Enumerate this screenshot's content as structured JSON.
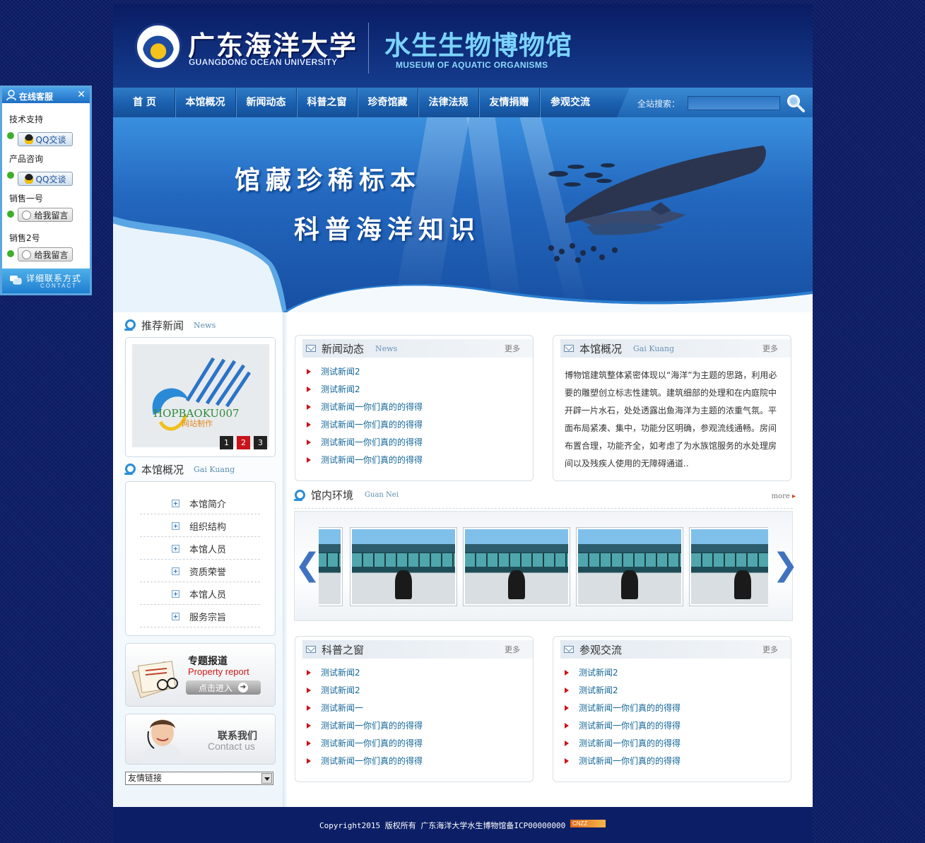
{
  "header": {
    "university_cn": "广东海洋大学",
    "university_en": "GUANGDONG OCEAN UNIVERSITY",
    "museum_cn": "水生生物博物馆",
    "museum_en": "MUSEUM OF AQUATIC ORGANISMS"
  },
  "nav": {
    "items": [
      "首 页",
      "本馆概况",
      "新闻动态",
      "科普之窗",
      "珍奇馆藏",
      "法律法规",
      "友情捐赠",
      "参观交流"
    ],
    "search_label": "全站搜索：",
    "search_value": ""
  },
  "banner": {
    "line1": "馆藏珍稀标本",
    "line2": "科普海洋知识"
  },
  "left": {
    "news_title": "推荐新闻",
    "news_en": "News",
    "news_img_text": "HOPBAOKU007",
    "news_img_sub": "网站制作",
    "slides": [
      "1",
      "2",
      "3"
    ],
    "about_title": "本馆概况",
    "about_en": "Gai Kuang",
    "menu": [
      "本馆简介",
      "组织结构",
      "本馆人员",
      "资质荣誉",
      "本馆人员",
      "服务宗旨"
    ],
    "promo1_cn": "专题报道",
    "promo1_en": "Property report",
    "promo1_btn": "点击进入",
    "promo2_cn": "联系我们",
    "promo2_en": "Contact us",
    "friend_links": "友情链接"
  },
  "panels": {
    "news": {
      "title": "新闻动态",
      "en": "News",
      "more": "更多",
      "items": [
        "测试新闻2",
        "测试新闻2",
        "测试新闻一你们真的的得得",
        "测试新闻一你们真的的得得",
        "测试新闻一你们真的的得得",
        "测试新闻一你们真的的得得"
      ]
    },
    "about": {
      "title": "本馆概况",
      "en": "Gai Kuang",
      "more": "更多",
      "text": "博物馆建筑整体紧密体现以“海洋”为主题的思路，利用必要的雕塑创立标志性建筑。建筑细部的处理和在内庭院中开辟一片水石，处处透露出鱼海洋为主题的浓重气氛。平面布局紧凑、集中，功能分区明确，参观流线通畅。房间布置合理，功能齐全，如考虑了为水族馆服务的水处理房间以及残疾人使用的无障碍通道.."
    },
    "science": {
      "title": "科普之窗",
      "more": "更多",
      "items": [
        "测试新闻2",
        "测试新闻2",
        "测试新闻一",
        "测试新闻一你们真的的得得",
        "测试新闻一你们真的的得得",
        "测试新闻一你们真的的得得"
      ]
    },
    "visit": {
      "title": "参观交流",
      "more": "更多",
      "items": [
        "测试新闻2",
        "测试新闻2",
        "测试新闻一你们真的的得得",
        "测试新闻一你们真的的得得",
        "测试新闻一你们真的的得得",
        "测试新闻一你们真的的得得"
      ]
    }
  },
  "gallery": {
    "title": "馆内环境",
    "en": "Guan Nei",
    "more": "more",
    "prev": "❮",
    "next": "❯"
  },
  "footer": {
    "copyright": "Copyright2015 版权所有 广东海洋大学水生博物馆备ICP00000000",
    "badge": "CNZZ"
  },
  "float": {
    "title": "在线客服",
    "close": "✕",
    "groups": [
      {
        "label": "技术支持",
        "button": "QQ交谈"
      },
      {
        "label": "产品咨询",
        "button": "QQ交谈"
      },
      {
        "label": "销售一号",
        "button": "给我留言"
      },
      {
        "label": "销售2号",
        "button": "给我留言"
      }
    ],
    "footer_cn": "详细联系方式",
    "footer_en": "CONTACT"
  },
  "colors": {
    "page_bg": "#0d1f6a",
    "nav_blue": "#1a5fae",
    "link_blue": "#15679a",
    "bullet_red": "#c8141c"
  }
}
